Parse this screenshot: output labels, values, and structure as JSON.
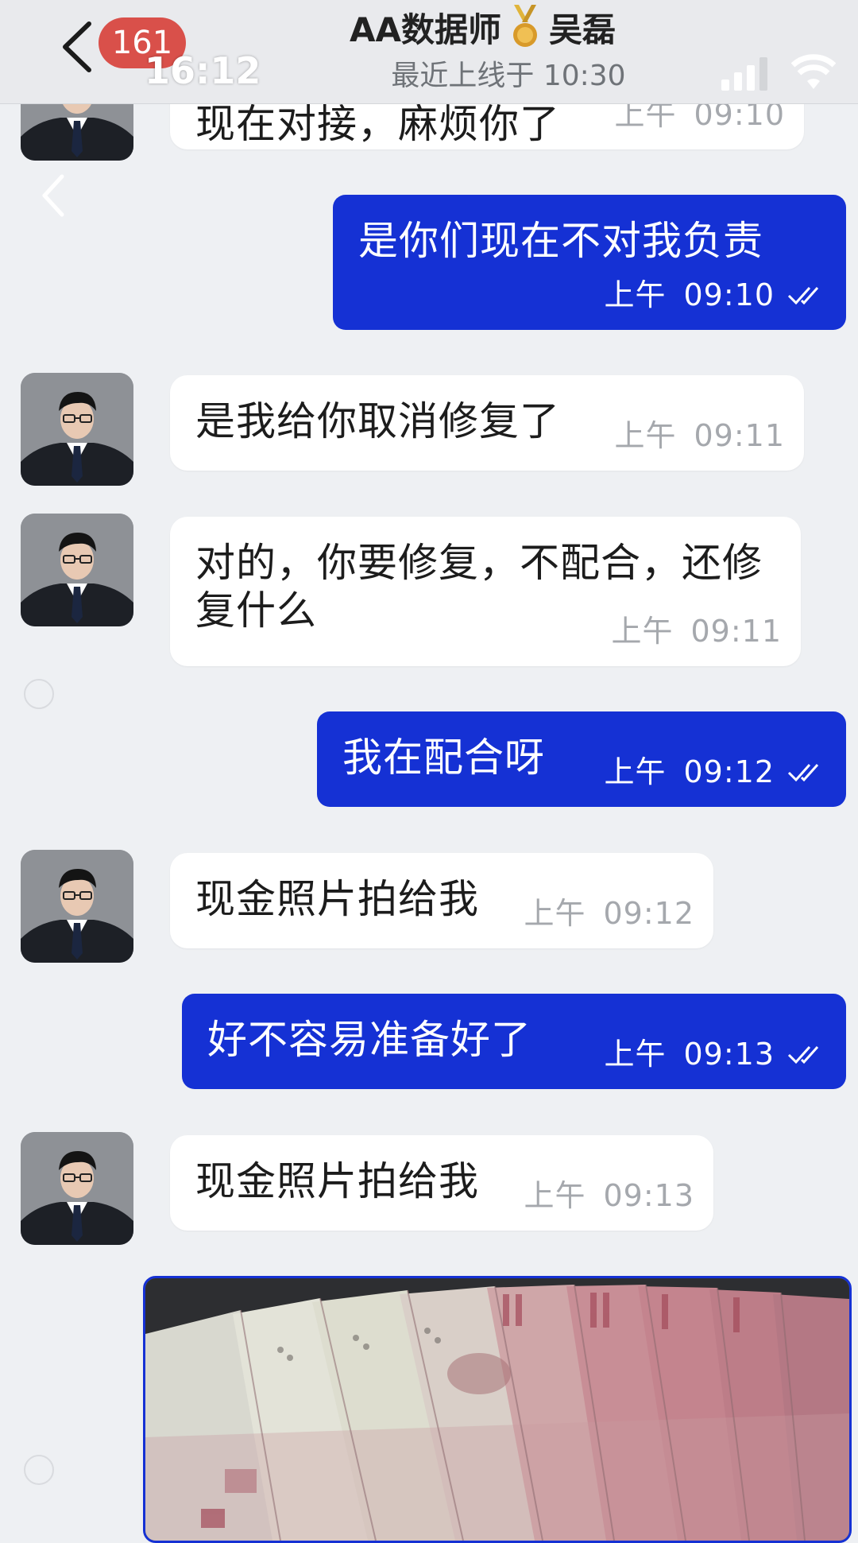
{
  "header": {
    "unread_count": "161",
    "status_time": "16:12",
    "title_left": "AA数据师",
    "title_right": "吴磊",
    "subtitle": "最近上线于 10:30"
  },
  "messages": [
    {
      "id": "m0",
      "side": "in",
      "text": "现在对接，麻烦你了",
      "ampm": "上午",
      "time": "09:10"
    },
    {
      "id": "m1",
      "side": "out",
      "text": "是你们现在不对我负责",
      "ampm": "上午",
      "time": "09:10"
    },
    {
      "id": "m2",
      "side": "in",
      "text": "是我给你取消修复了",
      "ampm": "上午",
      "time": "09:11"
    },
    {
      "id": "m3",
      "side": "in",
      "text": "对的，你要修复，不配合，还修复什么",
      "ampm": "上午",
      "time": "09:11"
    },
    {
      "id": "m4",
      "side": "out",
      "text": "我在配合呀",
      "ampm": "上午",
      "time": "09:12"
    },
    {
      "id": "m5",
      "side": "in",
      "text": "现金照片拍给我",
      "ampm": "上午",
      "time": "09:12"
    },
    {
      "id": "m6",
      "side": "out",
      "text": "好不容易准备好了",
      "ampm": "上午",
      "time": "09:13"
    },
    {
      "id": "m7",
      "side": "in",
      "text": "现金照片拍给我",
      "ampm": "上午",
      "time": "09:13"
    }
  ],
  "colors": {
    "outgoing_bubble": "#1531d4",
    "incoming_bubble": "#ffffff",
    "badge": "#d9504a",
    "background": "#eef0f3"
  },
  "icons": [
    "back-icon",
    "medal-icon",
    "signal-icon",
    "wifi-icon",
    "read-receipt-icon"
  ]
}
